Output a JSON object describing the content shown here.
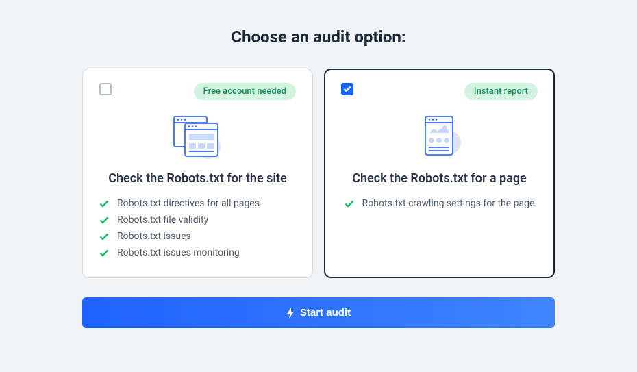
{
  "heading": "Choose an audit option:",
  "cards": [
    {
      "badge": "Free account needed",
      "title": "Check the Robots.txt for the site",
      "selected": false,
      "features": [
        "Robots.txt directives for all pages",
        "Robots.txt file validity",
        "Robots.txt issues",
        "Robots.txt issues monitoring"
      ]
    },
    {
      "badge": "Instant report",
      "title": "Check the Robots.txt for a page",
      "selected": true,
      "features": [
        "Robots.txt crawling settings for the page"
      ]
    }
  ],
  "cta": "Start audit"
}
